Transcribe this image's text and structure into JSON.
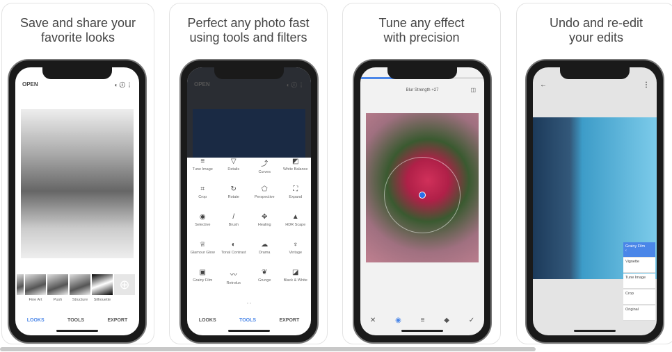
{
  "cards": [
    {
      "caption": "Save and share your\nfavorite looks",
      "open": "OPEN",
      "looks": [
        "Fine Art",
        "Push",
        "Structure",
        "Silhouette"
      ],
      "add_icon": "plus-circle-icon"
    },
    {
      "caption": "Perfect any photo fast\nusing tools and filters",
      "open": "OPEN",
      "tools": [
        [
          "Tune Image",
          "≡"
        ],
        [
          "Details",
          "▽"
        ],
        [
          "Curves",
          "⤴"
        ],
        [
          "White Balance",
          "◩"
        ],
        [
          "Crop",
          "⌗"
        ],
        [
          "Rotate",
          "↻"
        ],
        [
          "Perspective",
          "⬠"
        ],
        [
          "Expand",
          "⛶"
        ],
        [
          "Selective",
          "◉"
        ],
        [
          "Brush",
          "/"
        ],
        [
          "Healing",
          "✥"
        ],
        [
          "HDR Scape",
          "▲"
        ],
        [
          "Glamour Glow",
          "♕"
        ],
        [
          "Tonal Contrast",
          "◐"
        ],
        [
          "Drama",
          "☁"
        ],
        [
          "Vintage",
          "♆"
        ],
        [
          "Grainy Film",
          "▣"
        ],
        [
          "Retrolux",
          "〰"
        ],
        [
          "Grunge",
          "❦"
        ],
        [
          "Black & White",
          "◪"
        ]
      ]
    },
    {
      "caption": "Tune any effect\nwith precision",
      "status": "Blur Strength +27",
      "progress": 0.3
    },
    {
      "caption": "Undo and re-edit\nyour edits",
      "stack_title": "Grainy Film",
      "stack": [
        "Vignette",
        "Tune Image",
        "Crop",
        "Original"
      ]
    }
  ],
  "nav": {
    "looks": "LOOKS",
    "tools": "TOOLS",
    "export": "EXPORT"
  }
}
